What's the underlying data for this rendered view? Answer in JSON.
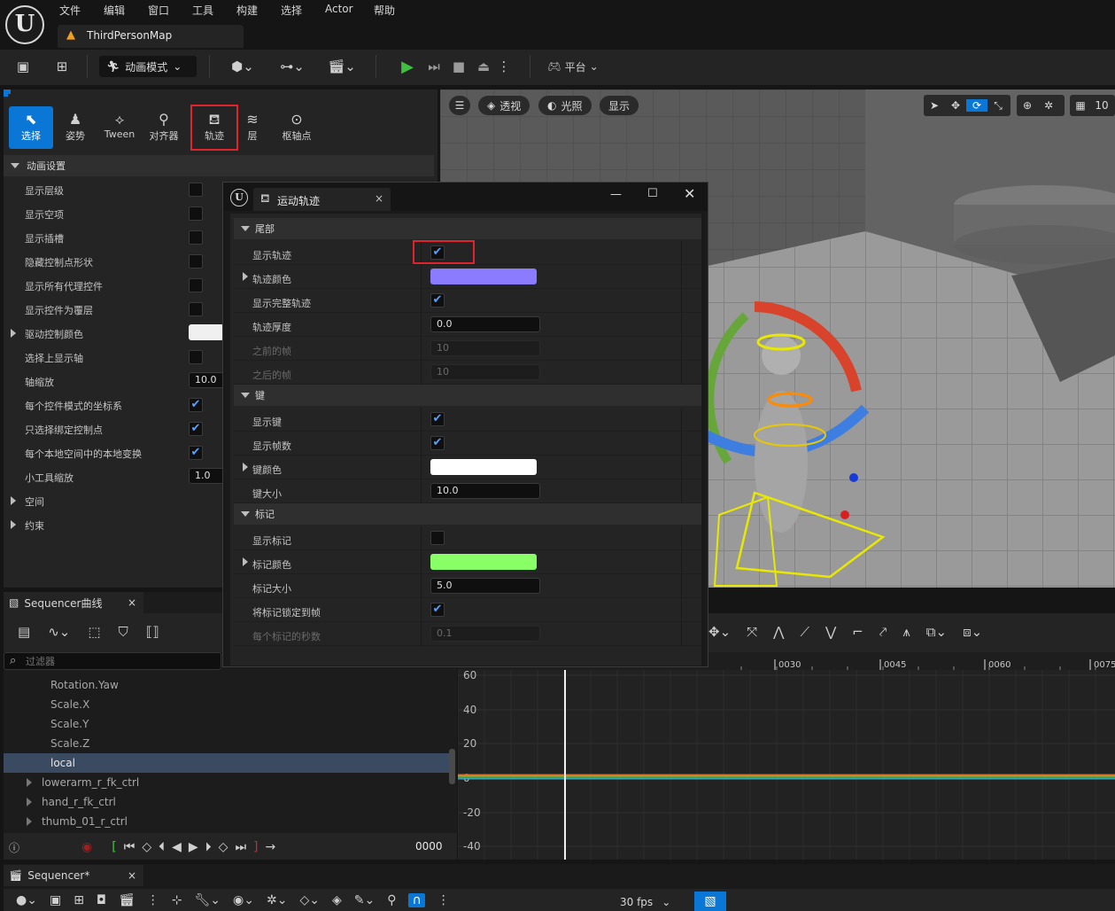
{
  "app": {
    "logo": "U",
    "menu": [
      "文件",
      "编辑",
      "窗口",
      "工具",
      "构建",
      "选择",
      "Actor",
      "帮助"
    ],
    "map_tab": "ThirdPersonMap"
  },
  "toolbar": {
    "mode_label": "动画模式",
    "platform_label": "平台"
  },
  "mode_tabs": [
    {
      "label": "选择",
      "icon": "select-icon"
    },
    {
      "label": "姿势",
      "icon": "pose-icon"
    },
    {
      "label": "Tween",
      "icon": "tween-icon"
    },
    {
      "label": "对齐器",
      "icon": "snapper-icon"
    },
    {
      "label": "轨迹",
      "icon": "trails-icon"
    },
    {
      "label": "层",
      "icon": "layers-icon"
    },
    {
      "label": "枢轴点",
      "icon": "pivot-icon"
    }
  ],
  "anim_settings": {
    "header": "动画设置",
    "rows": [
      {
        "label": "显示层级",
        "checked": false
      },
      {
        "label": "显示空项",
        "checked": false
      },
      {
        "label": "显示插槽",
        "checked": false
      },
      {
        "label": "隐藏控制点形状",
        "checked": false
      },
      {
        "label": "显示所有代理控件",
        "checked": false
      },
      {
        "label": "显示控件为覆层",
        "checked": false
      },
      {
        "label": "驱动控制颜色",
        "color": "#f0f0f0"
      },
      {
        "label": "选择上显示轴",
        "checked": false
      },
      {
        "label": "轴缩放",
        "value": "10.0"
      },
      {
        "label": "每个控件模式的坐标系",
        "checked": true
      },
      {
        "label": "只选择绑定控制点",
        "checked": true
      },
      {
        "label": "每个本地空间中的本地变换",
        "checked": true
      },
      {
        "label": "小工具缩放",
        "value": "1.0"
      }
    ],
    "collapsed": [
      "空间",
      "约束"
    ]
  },
  "viewport": {
    "perspective": "透视",
    "lighting": "光照",
    "show": "显示",
    "snap_value": "10"
  },
  "dialog": {
    "title": "运动轨迹",
    "sections": [
      {
        "header": "尾部",
        "rows": [
          {
            "label": "显示轨迹",
            "checked": true,
            "highlight": true
          },
          {
            "label": "轨迹颜色",
            "color": "#8a7bff",
            "expandable": true
          },
          {
            "label": "显示完整轨迹",
            "checked": true
          },
          {
            "label": "轨迹厚度",
            "value": "0.0"
          },
          {
            "label": "之前的帧",
            "value": "10",
            "disabled": true
          },
          {
            "label": "之后的帧",
            "value": "10",
            "disabled": true
          }
        ]
      },
      {
        "header": "键",
        "rows": [
          {
            "label": "显示键",
            "checked": true
          },
          {
            "label": "显示帧数",
            "checked": true
          },
          {
            "label": "键颜色",
            "color": "#ffffff",
            "expandable": true
          },
          {
            "label": "键大小",
            "value": "10.0"
          }
        ]
      },
      {
        "header": "标记",
        "rows": [
          {
            "label": "显示标记",
            "checked": false
          },
          {
            "label": "标记颜色",
            "color": "#88ff66",
            "expandable": true
          },
          {
            "label": "标记大小",
            "value": "5.0"
          },
          {
            "label": "将标记锁定到帧",
            "checked": true
          },
          {
            "label": "每个标记的秒数",
            "value": "0.1",
            "disabled": true
          }
        ]
      }
    ]
  },
  "curves": {
    "tab_label": "Sequencer曲线",
    "filter_placeholder": "过滤器",
    "tree_items": [
      {
        "label": "Rotation.Yaw",
        "indent": 2
      },
      {
        "label": "Scale.X",
        "indent": 2
      },
      {
        "label": "Scale.Y",
        "indent": 2
      },
      {
        "label": "Scale.Z",
        "indent": 2
      },
      {
        "label": "local",
        "indent": 2,
        "selected": true
      },
      {
        "label": "lowerarm_r_fk_ctrl",
        "indent": 1,
        "expandable": true
      },
      {
        "label": "hand_r_fk_ctrl",
        "indent": 1,
        "expandable": true
      },
      {
        "label": "thumb_01_r_ctrl",
        "indent": 1,
        "expandable": true
      }
    ],
    "frame_display": "0000",
    "y_ticks": [
      "60",
      "40",
      "20",
      "0",
      "-20",
      "-40"
    ],
    "x_ticks": [
      "0030",
      "0045",
      "0060",
      "0075"
    ]
  },
  "sequencer": {
    "tab_label": "Sequencer*",
    "fps_label": "30 fps"
  }
}
